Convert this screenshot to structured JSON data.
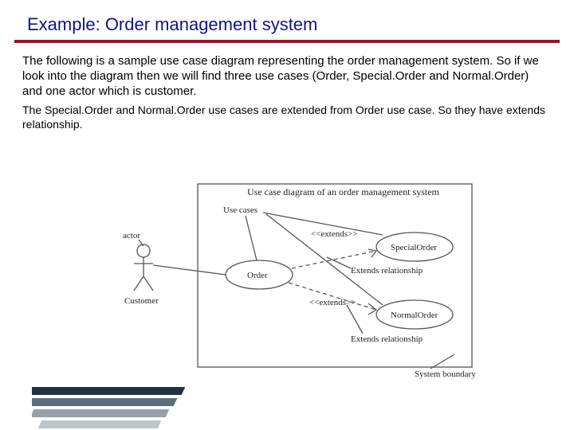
{
  "title": "Example: Order management system",
  "para1": "The following is a sample use case diagram representing the order management system. So if we look into the diagram then we will find three use cases (Order, Special.Order and Normal.Order) and one actor which is customer.",
  "para2": "The Special.Order and Normal.Order use cases are extended from Order use case. So they have extends relationship.",
  "diagram": {
    "title": "Use case diagram of an order management system",
    "actor_label": "actor",
    "actor_name": "Customer",
    "usecases_label": "Use cases",
    "order": "Order",
    "special": "SpecialOrder",
    "normal": "NormalOrder",
    "extends_stereo": "<<extends>>",
    "extends_rel": "Extends relationship",
    "system_boundary": "System boundary"
  }
}
